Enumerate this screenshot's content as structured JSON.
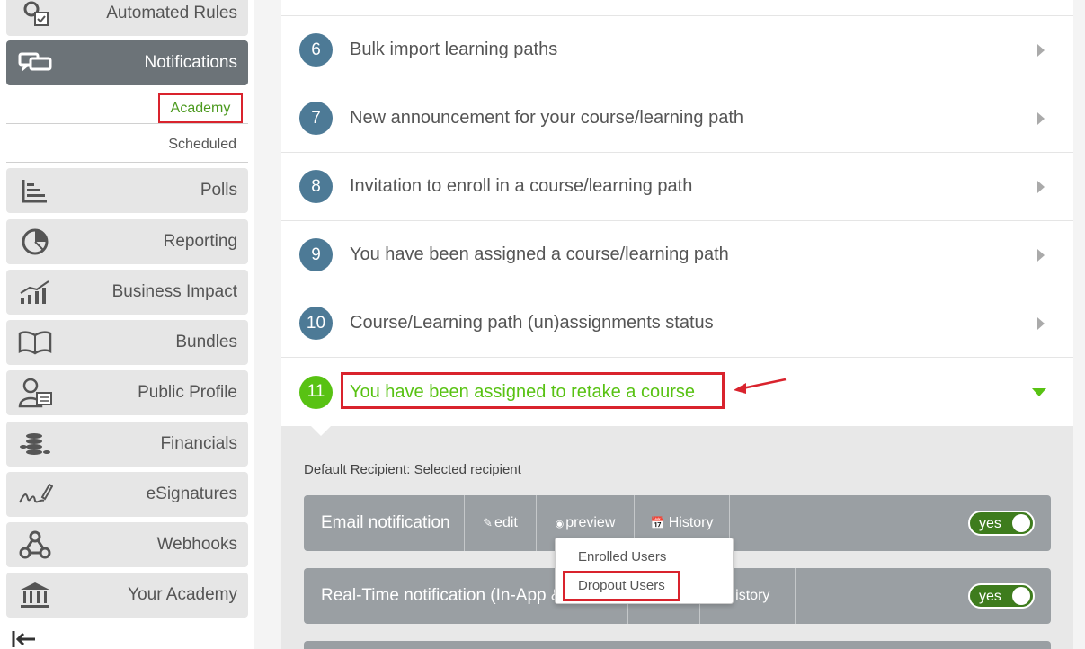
{
  "sidebar": {
    "items": [
      {
        "label": "Automated Rules",
        "icon": "gear-document-icon"
      },
      {
        "label": "Notifications",
        "icon": "chat-bubbles-icon"
      },
      {
        "label": "Polls",
        "icon": "bar-chart-icon"
      },
      {
        "label": "Reporting",
        "icon": "pie-chart-icon"
      },
      {
        "label": "Business Impact",
        "icon": "growth-chart-icon"
      },
      {
        "label": "Bundles",
        "icon": "open-book-icon"
      },
      {
        "label": "Public Profile",
        "icon": "user-card-icon"
      },
      {
        "label": "Financials",
        "icon": "coin-stack-icon"
      },
      {
        "label": "eSignatures",
        "icon": "signature-pen-icon"
      },
      {
        "label": "Webhooks",
        "icon": "webhook-icon"
      },
      {
        "label": "Your Academy",
        "icon": "bank-icon"
      }
    ],
    "sub": {
      "academy": "Academy",
      "scheduled": "Scheduled"
    },
    "collapse_icon": "collapse-left-icon"
  },
  "rows": [
    {
      "num": "6",
      "title": "Bulk import learning paths"
    },
    {
      "num": "7",
      "title": "New announcement for your course/learning path"
    },
    {
      "num": "8",
      "title": "Invitation to enroll in a course/learning path"
    },
    {
      "num": "9",
      "title": "You have been assigned a course/learning path"
    },
    {
      "num": "10",
      "title": "Course/Learning path (un)assignments status"
    },
    {
      "num": "11",
      "title": "You have been assigned to retake a course"
    }
  ],
  "expand": {
    "recipient": "Default Recipient: Selected recipient",
    "email": {
      "name": "Email notification",
      "edit": "edit",
      "preview": "preview",
      "history": "History",
      "toggle": "yes"
    },
    "realtime": {
      "name": "Real-Time notification (In-App &",
      "history": "History",
      "toggle": "yes"
    }
  },
  "dropdown": {
    "items": [
      "Enrolled Users",
      "Dropout Users"
    ]
  },
  "colors": {
    "accent_green": "#58c213",
    "number_blue": "#4d7a96",
    "highlight_red": "#d9232d"
  }
}
